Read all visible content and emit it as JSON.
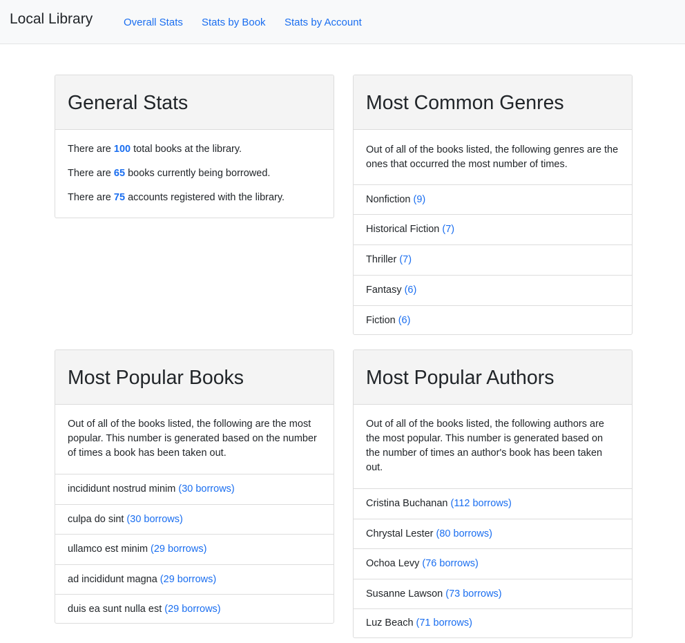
{
  "navbar": {
    "brand": "Local Library",
    "links": [
      "Overall Stats",
      "Stats by Book",
      "Stats by Account"
    ]
  },
  "general": {
    "title": "General Stats",
    "lines": [
      {
        "prefix": "There are",
        "value": "100",
        "suffix": "total books at the library."
      },
      {
        "prefix": "There are",
        "value": "65",
        "suffix": "books currently being borrowed."
      },
      {
        "prefix": "There are",
        "value": "75",
        "suffix": "accounts registered with the library."
      }
    ]
  },
  "genres": {
    "title": "Most Common Genres",
    "description": "Out of all of the books listed, the following genres are the ones that occurred the most number of times.",
    "items": [
      {
        "name": "Nonfiction",
        "count": "(9)"
      },
      {
        "name": "Historical Fiction",
        "count": "(7)"
      },
      {
        "name": "Thriller",
        "count": "(7)"
      },
      {
        "name": "Fantasy",
        "count": "(6)"
      },
      {
        "name": "Fiction",
        "count": "(6)"
      }
    ]
  },
  "books": {
    "title": "Most Popular Books",
    "description": "Out of all of the books listed, the following are the most popular. This number is generated based on the number of times a book has been taken out.",
    "items": [
      {
        "name": "incididunt nostrud minim",
        "count": "(30 borrows)"
      },
      {
        "name": "culpa do sint",
        "count": "(30 borrows)"
      },
      {
        "name": "ullamco est minim",
        "count": "(29 borrows)"
      },
      {
        "name": "ad incididunt magna",
        "count": "(29 borrows)"
      },
      {
        "name": "duis ea sunt nulla est",
        "count": "(29 borrows)"
      }
    ]
  },
  "authors": {
    "title": "Most Popular Authors",
    "description": "Out of all of the books listed, the following authors are the most popular. This number is generated based on the number of times an author's book has been taken out.",
    "items": [
      {
        "name": "Cristina Buchanan",
        "count": "(112 borrows)"
      },
      {
        "name": "Chrystal Lester",
        "count": "(80 borrows)"
      },
      {
        "name": "Ochoa Levy",
        "count": "(76 borrows)"
      },
      {
        "name": "Susanne Lawson",
        "count": "(73 borrows)"
      },
      {
        "name": "Luz Beach",
        "count": "(71 borrows)"
      }
    ]
  }
}
